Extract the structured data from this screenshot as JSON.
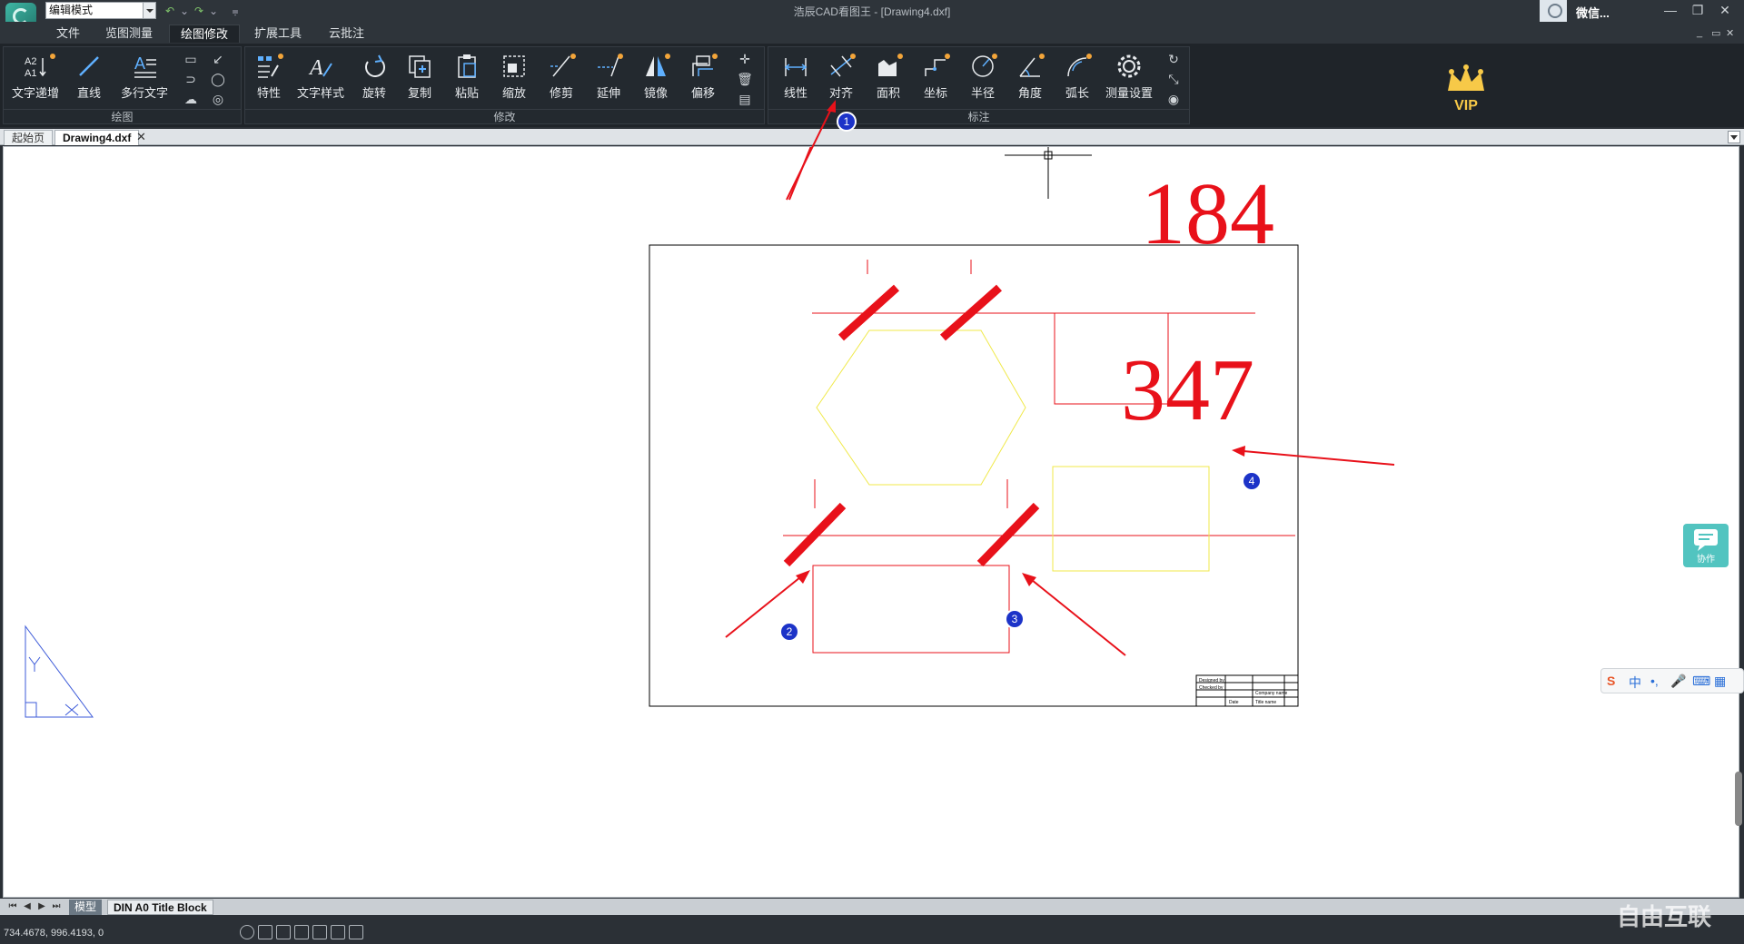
{
  "app": {
    "mode_select": "编辑模式",
    "window_title": "浩辰CAD看图王 - [Drawing4.dxf]",
    "user_name": "微信..."
  },
  "menu": {
    "tabs": [
      "文件",
      "览图测量",
      "绘图修改",
      "扩展工具",
      "云批注"
    ],
    "active_tab": "绘图修改"
  },
  "ribbon": {
    "groups": {
      "draw": "绘图",
      "modify": "修改",
      "annotate": "标注"
    },
    "draw_tools": [
      "文字递增",
      "直线",
      "多行文字"
    ],
    "modify_tools": [
      "特性",
      "文字样式",
      "旋转",
      "复制",
      "粘贴",
      "缩放",
      "修剪",
      "延伸",
      "镜像",
      "偏移"
    ],
    "annotate_tools": [
      "线性",
      "对齐",
      "面积",
      "坐标",
      "半径",
      "角度",
      "弧长",
      "测量设置"
    ],
    "vip_label": "VIP"
  },
  "doc_tabs": {
    "tabs": [
      "起始页",
      "Drawing4.dxf"
    ],
    "active": "Drawing4.dxf"
  },
  "drawing": {
    "dim_text_top": "184",
    "dim_text_right": "347",
    "title_block_text": [
      "Designed by",
      "Checked by",
      "Date",
      "Company name",
      "Title name"
    ],
    "callouts": [
      "1",
      "2",
      "3",
      "4"
    ],
    "colors": {
      "red": "#e8111a",
      "yellow": "#f0e94a",
      "black": "#000000",
      "blue_badge": "#1c33c8"
    }
  },
  "layout_tabs": {
    "tabs": [
      "模型",
      "DIN A0 Title Block"
    ],
    "active": "模型"
  },
  "status": {
    "coordinates": "734.4678, 996.4193, 0"
  },
  "side": {
    "collab_label": "协作",
    "ime_label": "中"
  },
  "watermark": "自由互联"
}
